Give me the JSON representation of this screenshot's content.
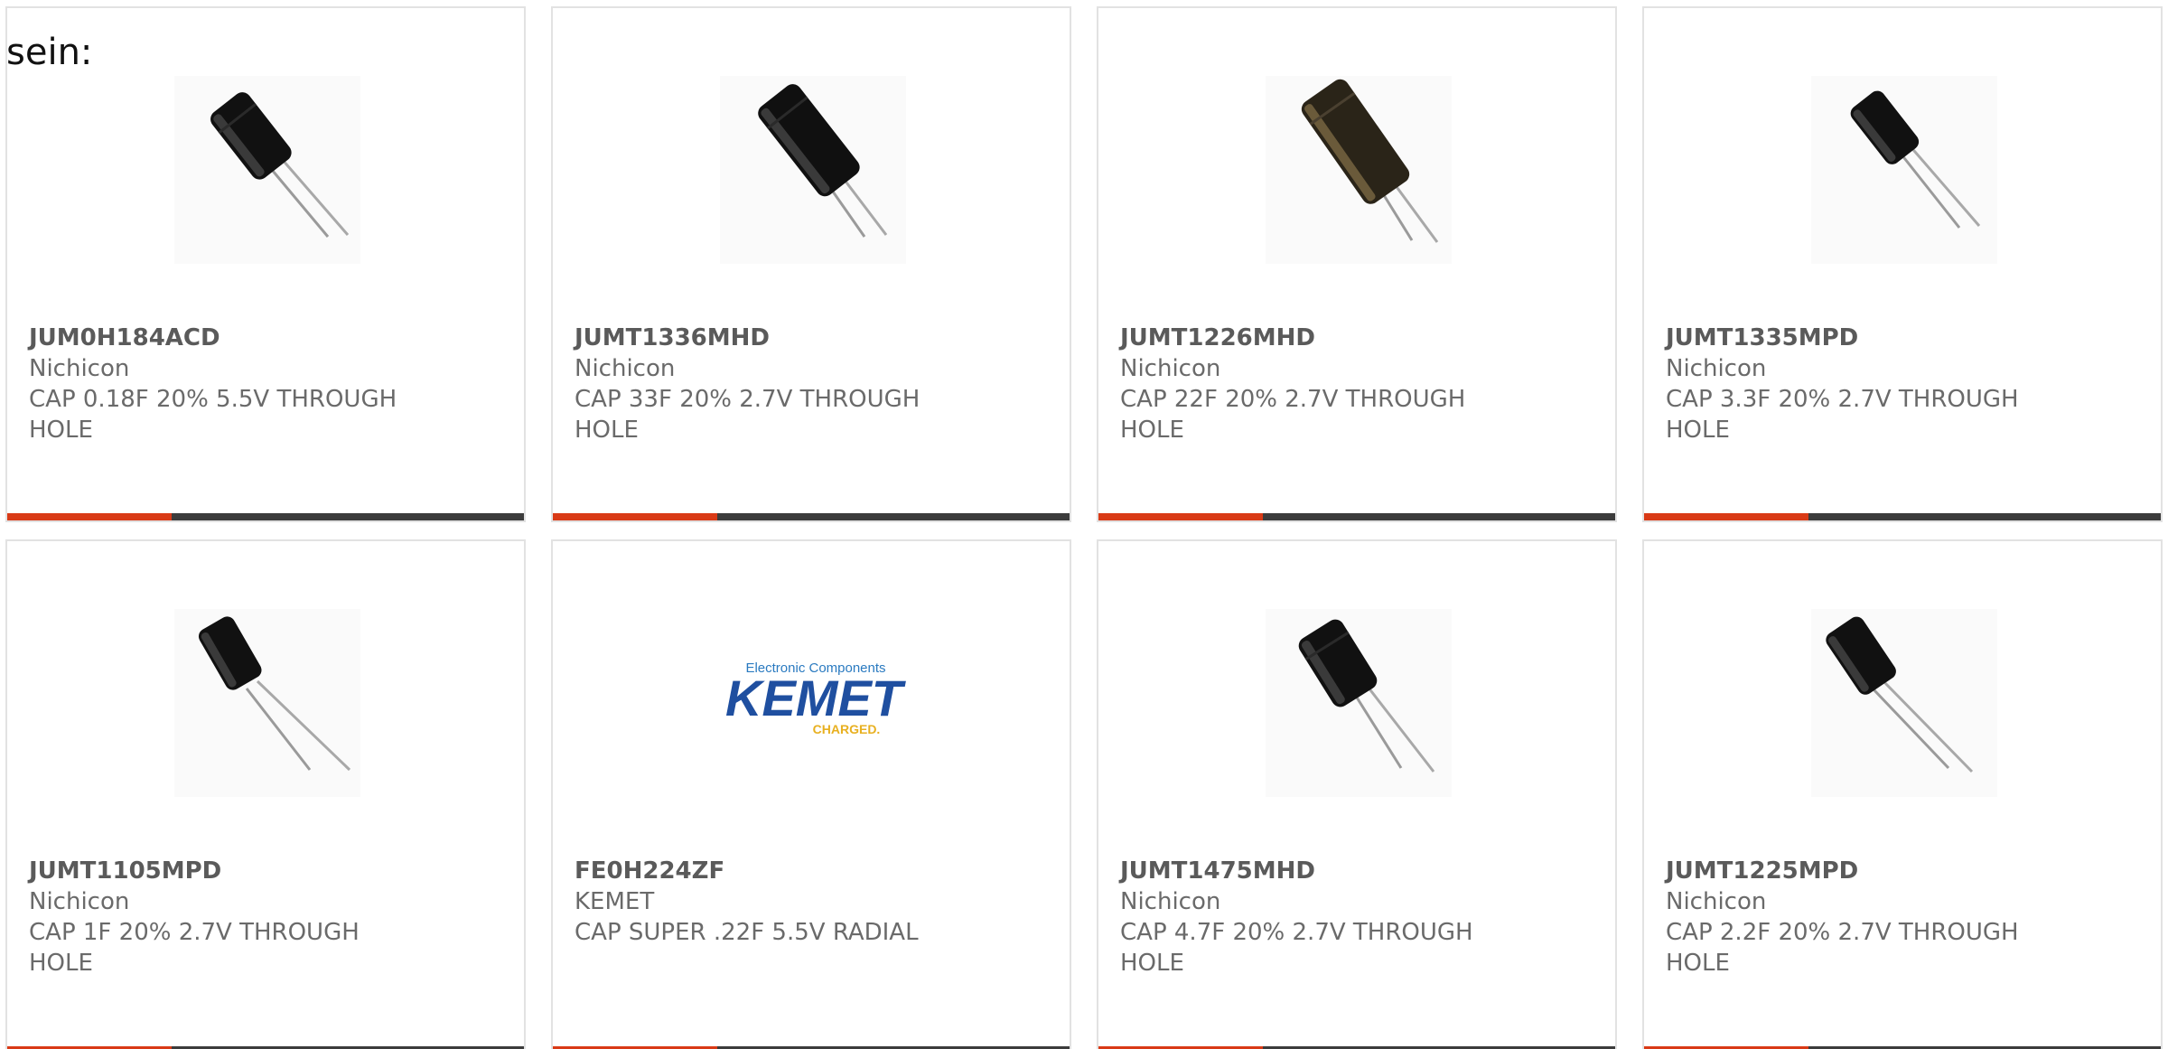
{
  "intro_text": "sein:",
  "colors": {
    "accent": "#d93a16",
    "bar": "#3c3c3c",
    "border": "#e2e2e2",
    "text": "#6a6a6a"
  },
  "products": [
    {
      "part": "JUM0H184ACD",
      "maker": "Nichicon",
      "desc": "CAP 0.18F 20% 5.5V THROUGH HOLE",
      "image": "capacitor-icon"
    },
    {
      "part": "JUMT1336MHD",
      "maker": "Nichicon",
      "desc": "CAP 33F 20% 2.7V THROUGH HOLE",
      "image": "capacitor-icon"
    },
    {
      "part": "JUMT1226MHD",
      "maker": "Nichicon",
      "desc": "CAP 22F 20% 2.7V THROUGH HOLE",
      "image": "capacitor-icon"
    },
    {
      "part": "JUMT1335MPD",
      "maker": "Nichicon",
      "desc": "CAP 3.3F 20% 2.7V THROUGH HOLE",
      "image": "capacitor-icon"
    },
    {
      "part": "JUMT1105MPD",
      "maker": "Nichicon",
      "desc": "CAP 1F 20% 2.7V THROUGH HOLE",
      "image": "capacitor-icon"
    },
    {
      "part": "FE0H224ZF",
      "maker": "KEMET",
      "desc": "CAP SUPER .22F 5.5V RADIAL",
      "image": "kemet-logo",
      "logo": {
        "tagline": "Electronic Components",
        "wordmark": "KEMET",
        "subline": "CHARGED."
      }
    },
    {
      "part": "JUMT1475MHD",
      "maker": "Nichicon",
      "desc": "CAP 4.7F 20% 2.7V THROUGH HOLE",
      "image": "capacitor-icon"
    },
    {
      "part": "JUMT1225MPD",
      "maker": "Nichicon",
      "desc": "CAP 2.2F 20% 2.7V THROUGH HOLE",
      "image": "capacitor-icon"
    }
  ]
}
